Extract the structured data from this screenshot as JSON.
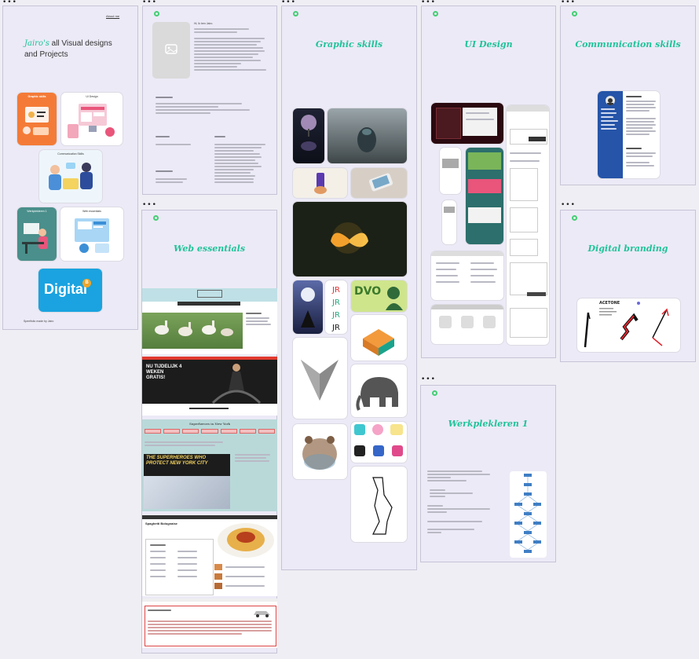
{
  "intro": {
    "link": "About me",
    "title_brand": "Jairo's",
    "title_rest_line1": " all Visual designs",
    "title_line2": "and Projects",
    "footer": "Speelfolio made by Jairo",
    "cards": [
      {
        "label": "Graphic skills"
      },
      {
        "label": "UI Design"
      },
      {
        "label": "Communication Skills"
      },
      {
        "label": "Werkplekleren 1"
      },
      {
        "label": "Web essentials"
      },
      {
        "label": "Digital"
      }
    ],
    "digital_badge": "B"
  },
  "about": {
    "greeting": "Hi, Ik ben Jairo."
  },
  "frames": {
    "graphic": "Graphic skills",
    "ui": "UI Design",
    "communication": "Communication skills",
    "web": "Web essentials",
    "branding": "Digital branding",
    "werkplek": "Werkplekleren 1"
  },
  "web": {
    "banner_text": "NU TIJDELIJK 4 WEKEN GRATIS!",
    "superheroes_heading": "Superheroes in New York",
    "superheroes_banner": "THE SUPERHEROES WHO PROTECT NEW YORK CITY",
    "spaghetti_title": "Spaghetti Bolognaise"
  },
  "branding": {
    "logo_text": "ACETONE"
  },
  "colors": {
    "accent": "#20c39a",
    "pin": "#43cf74",
    "frame_bg": "#eceaf6",
    "page_bg": "#efeef4",
    "digital_blue": "#1aa3e0",
    "orange": "#f47b37"
  }
}
